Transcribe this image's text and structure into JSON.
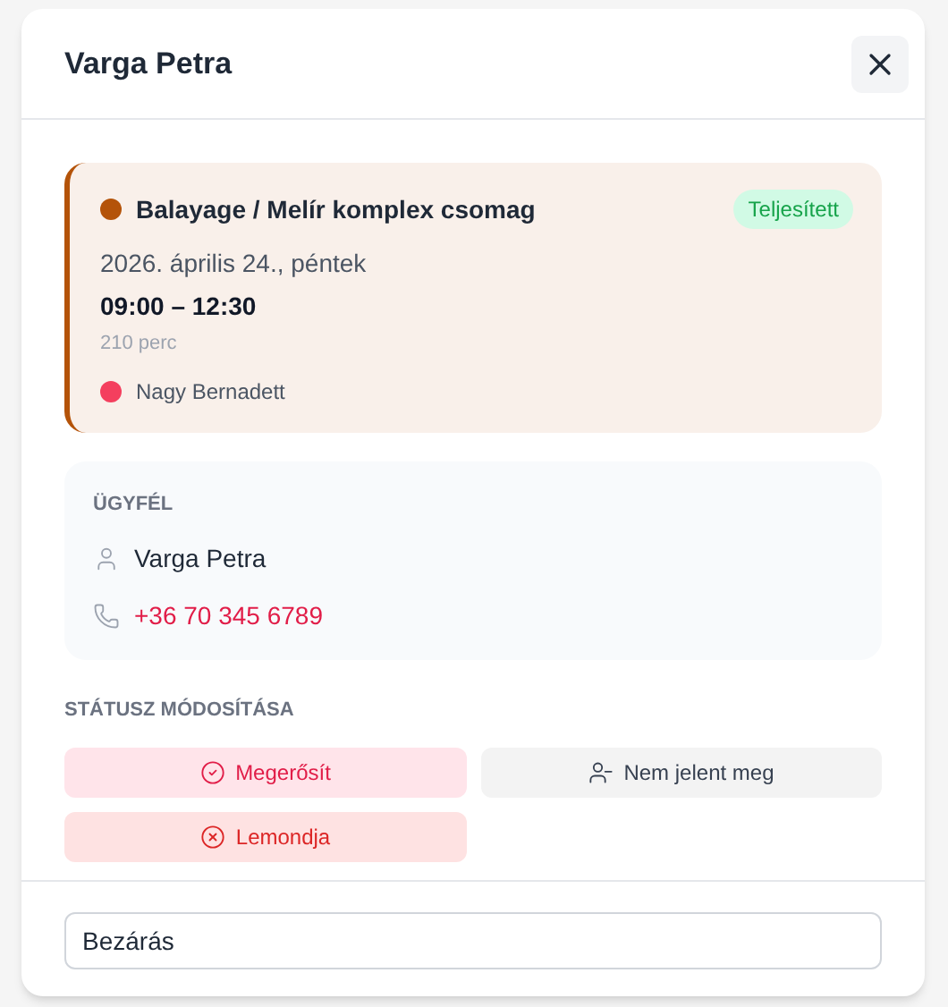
{
  "dialog": {
    "title": "Varga Petra"
  },
  "appointment": {
    "service": "Balayage / Melír komplex csomag",
    "color": "#b45309",
    "status": "Teljesített",
    "date": "2026. április 24., péntek",
    "time": "09:00 – 12:30",
    "duration": "210 perc",
    "staff": {
      "name": "Nagy Bernadett",
      "color": "#f43f5e"
    }
  },
  "client": {
    "heading": "ÜGYFÉL",
    "name": "Varga Petra",
    "phone": "+36 70 345 6789"
  },
  "status_change": {
    "heading": "STÁTUSZ MÓDOSÍTÁSA",
    "buttons": [
      {
        "kind": "confirm",
        "label": "Megerősít"
      },
      {
        "kind": "no_show",
        "label": "Nem jelent meg"
      },
      {
        "kind": "cancel",
        "label": "Lemondja"
      }
    ]
  },
  "footer": {
    "close_label": "Bezárás"
  }
}
